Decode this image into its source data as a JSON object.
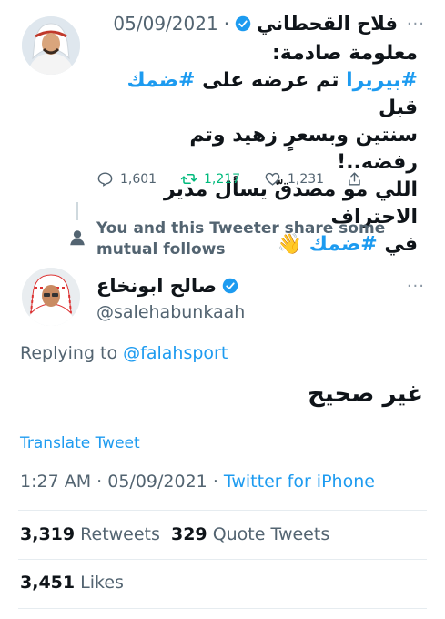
{
  "original_tweet": {
    "display_name": "فلاح القحطاني",
    "date": "05/09/2021",
    "separator": "·",
    "lines": [
      {
        "text": "معلومة صادمة:"
      },
      {
        "parts": [
          {
            "t": "#بيريرا",
            "tag": true
          },
          {
            "t": " تم عرضه على ",
            "tag": false
          },
          {
            "t": "#ضمك",
            "tag": true
          },
          {
            "t": " قبل",
            "tag": false
          }
        ]
      },
      {
        "text": "سنتين وبسعرٍ زهيد وتم رفضه..!"
      },
      {
        "text": "اللي مو مصدقّ يسأل مدير الاحتراف"
      },
      {
        "parts": [
          {
            "t": "في ",
            "tag": false
          },
          {
            "t": "#ضمك",
            "tag": true
          },
          {
            "t": " 👋",
            "tag": false
          }
        ]
      }
    ],
    "replies": "1,601",
    "retweets": "1,217",
    "likes": "1,231",
    "retweet_color": "#00ba7c"
  },
  "mutual": {
    "text_line1": "You and this Tweeter share some",
    "text_line2": "mutual follows"
  },
  "reply_tweet": {
    "display_name": "صالح ابونخاع",
    "handle": "@salehabunkaah",
    "replying_to_label": "Replying to",
    "replying_to_handle": "@falahsport",
    "text": "غير صحيح",
    "translate": "Translate Tweet",
    "time": "1:27 AM",
    "date": "05/09/2021",
    "dot": "·",
    "source": "Twitter for iPhone",
    "retweets_count": "3,319",
    "retweets_label": "Retweets",
    "quotes_count": "329",
    "quotes_label": "Quote Tweets",
    "likes_count": "3,451",
    "likes_label": "Likes"
  },
  "colors": {
    "accent": "#1d9bf0",
    "text": "#0f1419",
    "muted": "#536471"
  }
}
